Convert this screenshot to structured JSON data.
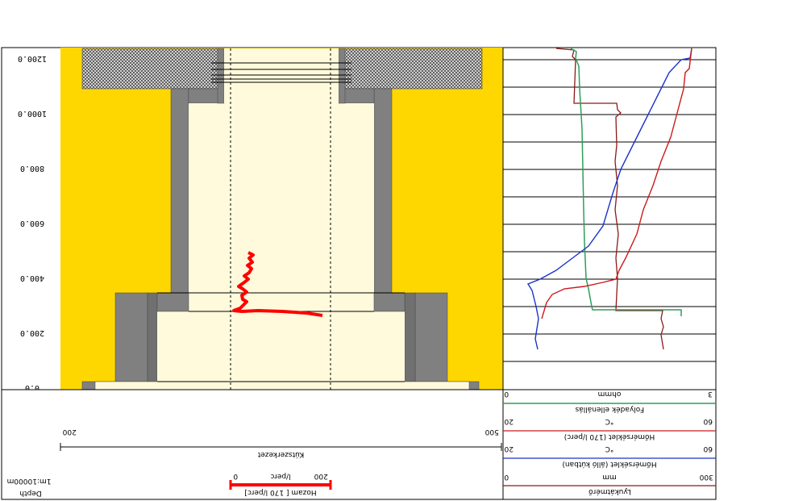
{
  "depth_axis": {
    "ticks": [
      "1200.0",
      "1000.0",
      "800.0",
      "600.0",
      "400.0",
      "200.0",
      "0.0"
    ]
  },
  "header_left": {
    "depth_title": "Depth",
    "scale": "1m:10000m",
    "hozam": {
      "title": "Hozam [ 170 l/perc]",
      "unit": "l/perc",
      "min": "0",
      "max": "200"
    },
    "kutszerkezet": {
      "title": "Kútszerkezet",
      "min": "200",
      "max": "500"
    }
  },
  "header_right": {
    "lyukatmero": {
      "title": "Lyukátmérő",
      "unit": "mm",
      "min": "0",
      "max": "300",
      "color": "#8b1a1a"
    },
    "homerseklet_allo": {
      "title": "Hőmérséklet (álló kútban)",
      "unit": "°C",
      "min": "20",
      "max": "60",
      "color": "#1a33cc"
    },
    "homerseklet_170": {
      "title": "Hőmérséklet (170 l/perc)",
      "unit": "°C",
      "min": "20",
      "max": "60",
      "color": "#cc1a1a"
    },
    "folyadek": {
      "title": "Folyadék ellenállás",
      "unit": "ohmm",
      "min": "0",
      "max": "3",
      "color": "#2e9e5b"
    }
  },
  "colors": {
    "formation": "#ffd700",
    "casing": "#808080",
    "interior": "#fffadc",
    "flow": "#ff0000"
  }
}
